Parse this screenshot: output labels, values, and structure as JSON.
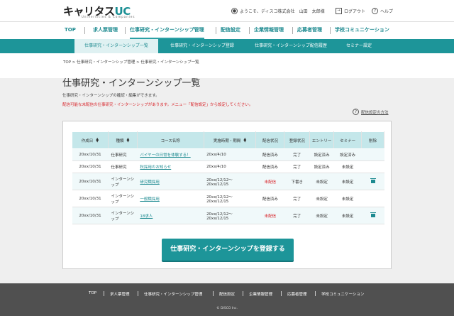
{
  "header": {
    "logo_main": "キャリタス",
    "logo_uc": "UC",
    "logo_sub": "Universities & Companies",
    "greeting": "ようこそ、ディスコ株式会社　山田　太郎様",
    "logout": "ログアウト",
    "help": "ヘルプ"
  },
  "mainnav": [
    {
      "label": "TOP"
    },
    {
      "label": "求人票管理"
    },
    {
      "label": "仕事研究・インターンシップ管理"
    },
    {
      "label": "配信設定"
    },
    {
      "label": "企業情報管理"
    },
    {
      "label": "応募者管理"
    },
    {
      "label": "学校コミュニケーション"
    }
  ],
  "subnav": [
    {
      "label": "仕事研究・インターンシップ一覧"
    },
    {
      "label": "仕事研究・インターンシップ登録"
    },
    {
      "label": "仕事研究・インターンシップ配信履歴"
    },
    {
      "label": "セミナー設定"
    }
  ],
  "breadcrumb": "TOP > 仕事研究・インターンシップ管理 > 仕事研究・インターンシップ一覧",
  "page": {
    "title": "仕事研究・インターンシップ一覧",
    "description": "仕事研究・インターンシップの確認・編集ができます。",
    "warning": "配信可能な未配信の仕事研究・インターンシップがあります。メニュー「配信設定」から設定してください。",
    "help_link": "配信設定の方法"
  },
  "table": {
    "headers": [
      "作成日",
      "種類",
      "コース名称",
      "実施時期・期間",
      "配信状況",
      "登録状況",
      "エントリー",
      "セミナー",
      "削除"
    ],
    "rows": [
      {
        "date": "20xx/10/31",
        "type": "仕事研究",
        "course": "バイヤーの日常を体験する！",
        "period": "20xx/4/10",
        "delivery": "配信済み",
        "registration": "完了",
        "entry": "設定済み",
        "seminar": "設定済み"
      },
      {
        "date": "20xx/10/31",
        "type": "仕事研究",
        "course": "秋採用のお知らせ",
        "period": "20xx/4/10",
        "delivery": "配信済み",
        "registration": "完了",
        "entry": "設定済み",
        "seminar": "未設定"
      },
      {
        "date": "20xx/10/31",
        "type": "インターンシップ",
        "course": "研究職採用",
        "period": "20xx/12/12～20xx/12/15",
        "delivery": "未配信",
        "registration": "下書き",
        "entry": "未設定",
        "seminar": "未設定"
      },
      {
        "date": "20xx/10/31",
        "type": "インターンシップ",
        "course": "一般職採用",
        "period": "20xx/12/12～20xx/12/15",
        "delivery": "配信済み",
        "registration": "完了",
        "entry": "未設定",
        "seminar": "未設定"
      },
      {
        "date": "20xx/10/31",
        "type": "インターンシップ",
        "course": "18求人",
        "period": "20xx/12/12～20xx/12/15",
        "delivery": "未配信",
        "registration": "完了",
        "entry": "未設定",
        "seminar": "未設定"
      }
    ]
  },
  "register_button": "仕事研究・インターンシップを登録する",
  "footer": {
    "links": [
      "TOP",
      "求人票管理",
      "仕事研究・インターンシップ管理",
      "配信設定",
      "企業情報管理",
      "応募者管理",
      "学校コミュニケーション"
    ],
    "copyright": "© DISCO Inc."
  },
  "colors": {
    "accent": "#1d9599",
    "warning": "#d8242a",
    "table_header": "#c4e7ea",
    "footer": "#505050"
  },
  "icons": {
    "user": "user-icon",
    "logout": "logout-icon",
    "help": "question-icon",
    "sort": "sort-icon",
    "delete": "trash-icon"
  }
}
